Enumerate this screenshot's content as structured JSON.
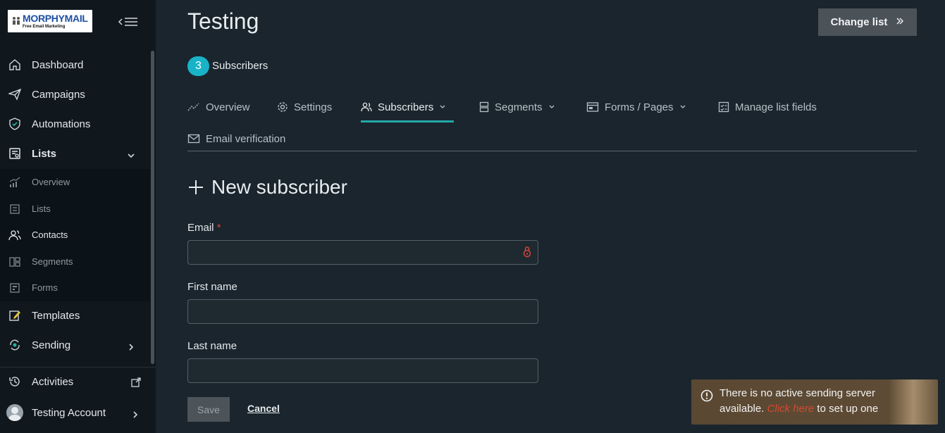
{
  "brand": {
    "logo_text": "MORPHYMAIL",
    "logo_tagline": "Free Email Marketing"
  },
  "sidebar": {
    "items": [
      {
        "label": "Dashboard",
        "icon": "home-icon"
      },
      {
        "label": "Campaigns",
        "icon": "send-icon"
      },
      {
        "label": "Automations",
        "icon": "shield-check-icon"
      },
      {
        "label": "Lists",
        "icon": "list-icon",
        "expanded": true
      },
      {
        "label": "Templates",
        "icon": "edit-icon"
      },
      {
        "label": "Sending",
        "icon": "refresh-icon"
      },
      {
        "label": "Activities",
        "icon": "history-icon"
      },
      {
        "label": "Testing Account",
        "icon": "user-avatar"
      }
    ],
    "submenu": [
      {
        "label": "Overview",
        "icon": "chart-icon"
      },
      {
        "label": "Lists",
        "icon": "list-icon"
      },
      {
        "label": "Contacts",
        "icon": "users-icon"
      },
      {
        "label": "Segments",
        "icon": "segments-icon"
      },
      {
        "label": "Forms",
        "icon": "form-icon"
      }
    ]
  },
  "header": {
    "title": "Testing",
    "change_list_label": "Change list",
    "subscriber_count": "3",
    "subscriber_label": "Subscribers"
  },
  "tabs": [
    {
      "label": "Overview"
    },
    {
      "label": "Settings"
    },
    {
      "label": "Subscribers",
      "active": true
    },
    {
      "label": "Segments"
    },
    {
      "label": "Forms / Pages"
    },
    {
      "label": "Manage list fields"
    },
    {
      "label": "Email verification"
    }
  ],
  "form": {
    "title": "New subscriber",
    "email_label": "Email",
    "email_required_marker": "*",
    "email_value": "",
    "first_name_label": "First name",
    "first_name_value": "",
    "last_name_label": "Last name",
    "last_name_value": "",
    "save_label": "Save",
    "cancel_label": "Cancel"
  },
  "toast": {
    "line1": "There is no active sending server",
    "line2_prefix": "available.",
    "link_text": "Click here",
    "line2_suffix": "to set up one"
  },
  "colors": {
    "accent": "#19b3c8",
    "tab_underline": "#23a8a8",
    "required": "#d4453b",
    "toast_link": "#d8482e"
  }
}
